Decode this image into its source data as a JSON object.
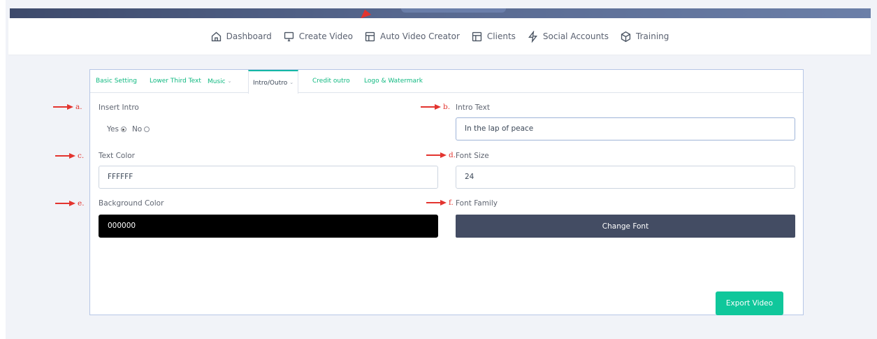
{
  "top_nav": {
    "items": [
      {
        "label": "Dashboard",
        "icon": "home-icon"
      },
      {
        "label": "Create Video",
        "icon": "monitor-icon"
      },
      {
        "label": "Auto Video Creator",
        "icon": "layout-icon"
      },
      {
        "label": "Clients",
        "icon": "layout-icon"
      },
      {
        "label": "Social Accounts",
        "icon": "lightning-icon"
      },
      {
        "label": "Training",
        "icon": "cube-icon"
      }
    ]
  },
  "tabs": [
    {
      "label": "Basic Setting"
    },
    {
      "label": "Lower Third Text"
    },
    {
      "label": "Music",
      "dropdown": true
    },
    {
      "label": "Intro/Outro",
      "dropdown": true,
      "active": true
    },
    {
      "label": "Credit outro"
    },
    {
      "label": "Logo & Watermark"
    }
  ],
  "form": {
    "insert_intro": {
      "label": "Insert Intro",
      "options": [
        "Yes",
        "No"
      ],
      "selected": "Yes"
    },
    "intro_text": {
      "label": "Intro Text",
      "value": "In the lap of peace"
    },
    "text_color": {
      "label": "Text Color",
      "value": "FFFFFF"
    },
    "font_size": {
      "label": "Font Size",
      "value": "24"
    },
    "background_color": {
      "label": "Background Color",
      "value": "000000"
    },
    "font_family": {
      "label": "Font Family",
      "button_label": "Change Font"
    }
  },
  "export_button": {
    "label": "Export Video"
  },
  "annotations": [
    "a.",
    "b.",
    "c.",
    "d.",
    "e.",
    "f."
  ],
  "colors": {
    "accent": "#10c79b",
    "tab_text": "#10b981",
    "annotation": "#e3342f",
    "dark_button": "#434c63",
    "banner": "#4a5a80"
  }
}
